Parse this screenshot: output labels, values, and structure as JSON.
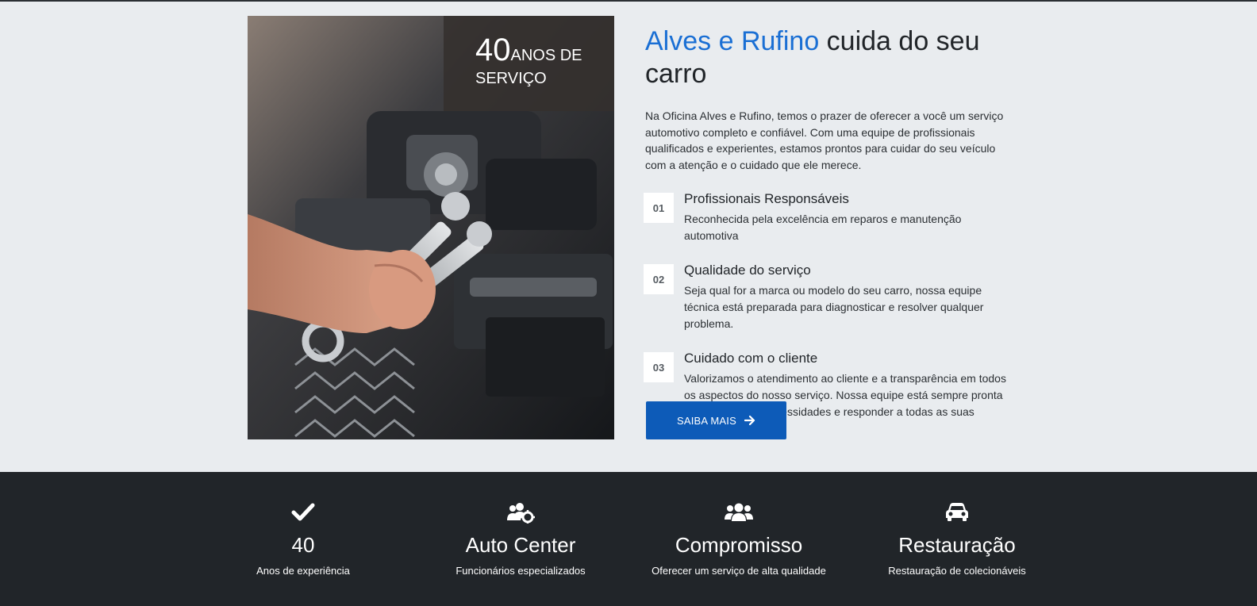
{
  "about": {
    "badge": {
      "number": "40",
      "text_line1": "ANOS DE",
      "text_line2": "SERVIÇO"
    },
    "headline": {
      "brand": "Alves e Rufino",
      "rest": " cuida do seu carro"
    },
    "intro": "Na Oficina Alves e Rufino, temos o prazer de oferecer a você um serviço automotivo completo e confiável. Com uma equipe de profissionais qualificados e experientes, estamos prontos para cuidar do seu veículo com a atenção e o cuidado que ele merece.",
    "features": [
      {
        "num": "01",
        "title": "Profissionais Responsáveis",
        "text": "Reconhecida pela excelência em reparos e manutenção automotiva"
      },
      {
        "num": "02",
        "title": "Qualidade do serviço",
        "text": "Seja qual for a marca ou modelo do seu carro, nossa equipe técnica está preparada para diagnosticar e resolver qualquer problema."
      },
      {
        "num": "03",
        "title": "Cuidado com o cliente",
        "text": "Valorizamos o atendimento ao cliente e a transparência em todos os aspectos do nosso serviço. Nossa equipe está sempre pronta para ouvir suas necessidades e responder a todas as suas perguntas."
      }
    ],
    "cta_label": "SAIBA MAIS",
    "colors": {
      "brand": "#1a6fd4",
      "button": "#0d5bb8"
    }
  },
  "stats": [
    {
      "icon": "check-icon",
      "title": "40",
      "subtitle": "Anos de experiência"
    },
    {
      "icon": "users-cog-icon",
      "title": "Auto Center",
      "subtitle": "Funcionários especializados"
    },
    {
      "icon": "users-icon",
      "title": "Compromisso",
      "subtitle": "Oferecer um serviço de alta qualidade"
    },
    {
      "icon": "car-icon",
      "title": "Restauração",
      "subtitle": "Restauração de colecionáveis"
    }
  ]
}
